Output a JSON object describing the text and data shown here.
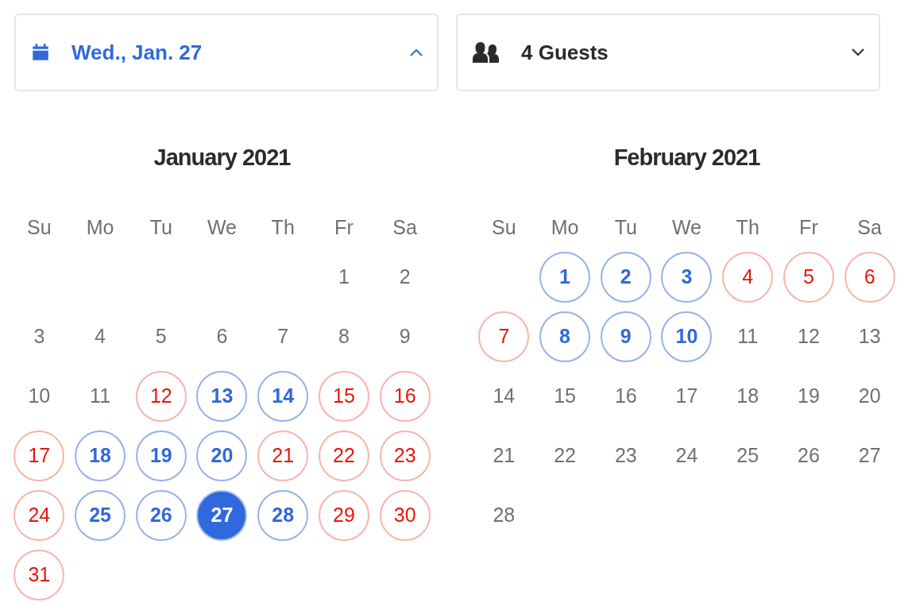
{
  "date_picker": {
    "label": "Wed., Jan. 27",
    "expanded": true
  },
  "guests_picker": {
    "label": "4 Guests",
    "expanded": false
  },
  "months": [
    {
      "title": "January 2021",
      "weekdays": [
        "Su",
        "Mo",
        "Tu",
        "We",
        "Th",
        "Fr",
        "Sa"
      ],
      "weeks": [
        [
          {
            "kind": "blank"
          },
          {
            "kind": "blank"
          },
          {
            "kind": "blank"
          },
          {
            "kind": "blank"
          },
          {
            "kind": "blank"
          },
          {
            "label": "1",
            "kind": "plain",
            "selected": false
          },
          {
            "label": "2",
            "kind": "plain",
            "selected": false
          }
        ],
        [
          {
            "label": "3",
            "kind": "plain",
            "selected": false
          },
          {
            "label": "4",
            "kind": "plain",
            "selected": false
          },
          {
            "label": "5",
            "kind": "plain",
            "selected": false
          },
          {
            "label": "6",
            "kind": "plain",
            "selected": false
          },
          {
            "label": "7",
            "kind": "plain",
            "selected": false
          },
          {
            "label": "8",
            "kind": "plain",
            "selected": false
          },
          {
            "label": "9",
            "kind": "plain",
            "selected": false
          }
        ],
        [
          {
            "label": "10",
            "kind": "plain",
            "selected": false
          },
          {
            "label": "11",
            "kind": "plain",
            "selected": false
          },
          {
            "label": "12",
            "kind": "unavailable",
            "selected": false
          },
          {
            "label": "13",
            "kind": "available",
            "selected": false
          },
          {
            "label": "14",
            "kind": "available",
            "selected": false
          },
          {
            "label": "15",
            "kind": "unavailable",
            "selected": false
          },
          {
            "label": "16",
            "kind": "unavailable",
            "selected": false
          }
        ],
        [
          {
            "label": "17",
            "kind": "unavailable",
            "selected": false
          },
          {
            "label": "18",
            "kind": "available",
            "selected": false
          },
          {
            "label": "19",
            "kind": "available",
            "selected": false
          },
          {
            "label": "20",
            "kind": "available",
            "selected": false
          },
          {
            "label": "21",
            "kind": "unavailable",
            "selected": false
          },
          {
            "label": "22",
            "kind": "unavailable",
            "selected": false
          },
          {
            "label": "23",
            "kind": "unavailable",
            "selected": false
          }
        ],
        [
          {
            "label": "24",
            "kind": "unavailable",
            "selected": false
          },
          {
            "label": "25",
            "kind": "available",
            "selected": false
          },
          {
            "label": "26",
            "kind": "available",
            "selected": false
          },
          {
            "label": "27",
            "kind": "available",
            "selected": true
          },
          {
            "label": "28",
            "kind": "available",
            "selected": false
          },
          {
            "label": "29",
            "kind": "unavailable",
            "selected": false
          },
          {
            "label": "30",
            "kind": "unavailable",
            "selected": false
          }
        ],
        [
          {
            "label": "31",
            "kind": "unavailable",
            "selected": false
          }
        ]
      ]
    },
    {
      "title": "February 2021",
      "weekdays": [
        "Su",
        "Mo",
        "Tu",
        "We",
        "Th",
        "Fr",
        "Sa"
      ],
      "weeks": [
        [
          {
            "kind": "blank"
          },
          {
            "label": "1",
            "kind": "available",
            "selected": false
          },
          {
            "label": "2",
            "kind": "available",
            "selected": false
          },
          {
            "label": "3",
            "kind": "available",
            "selected": false
          },
          {
            "label": "4",
            "kind": "unavailable",
            "selected": false
          },
          {
            "label": "5",
            "kind": "unavailable",
            "selected": false
          },
          {
            "label": "6",
            "kind": "unavailable",
            "selected": false
          }
        ],
        [
          {
            "label": "7",
            "kind": "unavailable",
            "selected": false
          },
          {
            "label": "8",
            "kind": "available",
            "selected": false
          },
          {
            "label": "9",
            "kind": "available",
            "selected": false
          },
          {
            "label": "10",
            "kind": "available",
            "selected": false
          },
          {
            "label": "11",
            "kind": "plain",
            "selected": false
          },
          {
            "label": "12",
            "kind": "plain",
            "selected": false
          },
          {
            "label": "13",
            "kind": "plain",
            "selected": false
          }
        ],
        [
          {
            "label": "14",
            "kind": "plain",
            "selected": false
          },
          {
            "label": "15",
            "kind": "plain",
            "selected": false
          },
          {
            "label": "16",
            "kind": "plain",
            "selected": false
          },
          {
            "label": "17",
            "kind": "plain",
            "selected": false
          },
          {
            "label": "18",
            "kind": "plain",
            "selected": false
          },
          {
            "label": "19",
            "kind": "plain",
            "selected": false
          },
          {
            "label": "20",
            "kind": "plain",
            "selected": false
          }
        ],
        [
          {
            "label": "21",
            "kind": "plain",
            "selected": false
          },
          {
            "label": "22",
            "kind": "plain",
            "selected": false
          },
          {
            "label": "23",
            "kind": "plain",
            "selected": false
          },
          {
            "label": "24",
            "kind": "plain",
            "selected": false
          },
          {
            "label": "25",
            "kind": "plain",
            "selected": false
          },
          {
            "label": "26",
            "kind": "plain",
            "selected": false
          },
          {
            "label": "27",
            "kind": "plain",
            "selected": false
          }
        ],
        [
          {
            "label": "28",
            "kind": "plain",
            "selected": false
          }
        ]
      ]
    }
  ]
}
